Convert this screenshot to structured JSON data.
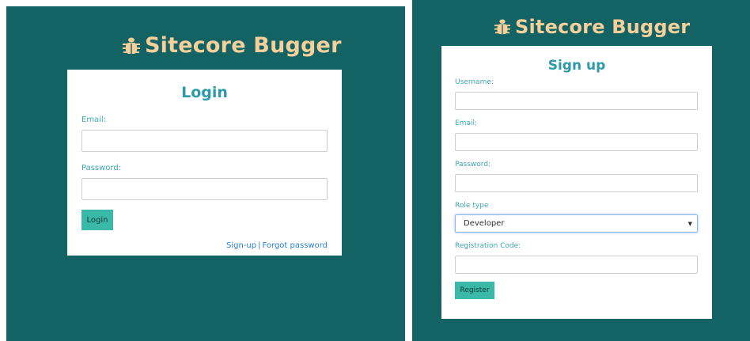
{
  "login": {
    "brand": "Sitecore Bugger",
    "title": "Login",
    "email_label": "Email:",
    "email_value": "",
    "password_label": "Password:",
    "password_value": "",
    "submit_label": "Login",
    "signup_link": "Sign-up",
    "separator": "|",
    "forgot_link": "Forgot password"
  },
  "signup": {
    "brand": "Sitecore Bugger",
    "title": "Sign up",
    "username_label": "Username:",
    "username_value": "",
    "email_label": "Email:",
    "email_value": "",
    "password_label": "Password:",
    "password_value": "",
    "role_label": "Role type",
    "role_selected": "Developer",
    "code_label": "Registration Code:",
    "code_value": "",
    "submit_label": "Register"
  },
  "colors": {
    "background": "#136364",
    "brand": "#f7cf9a",
    "heading": "#2d9aa5",
    "button": "#3bb9a8",
    "link": "#2a7fd0"
  },
  "icons": {
    "brand_icon": "bug-icon",
    "select_icon": "chevron-down-icon"
  }
}
